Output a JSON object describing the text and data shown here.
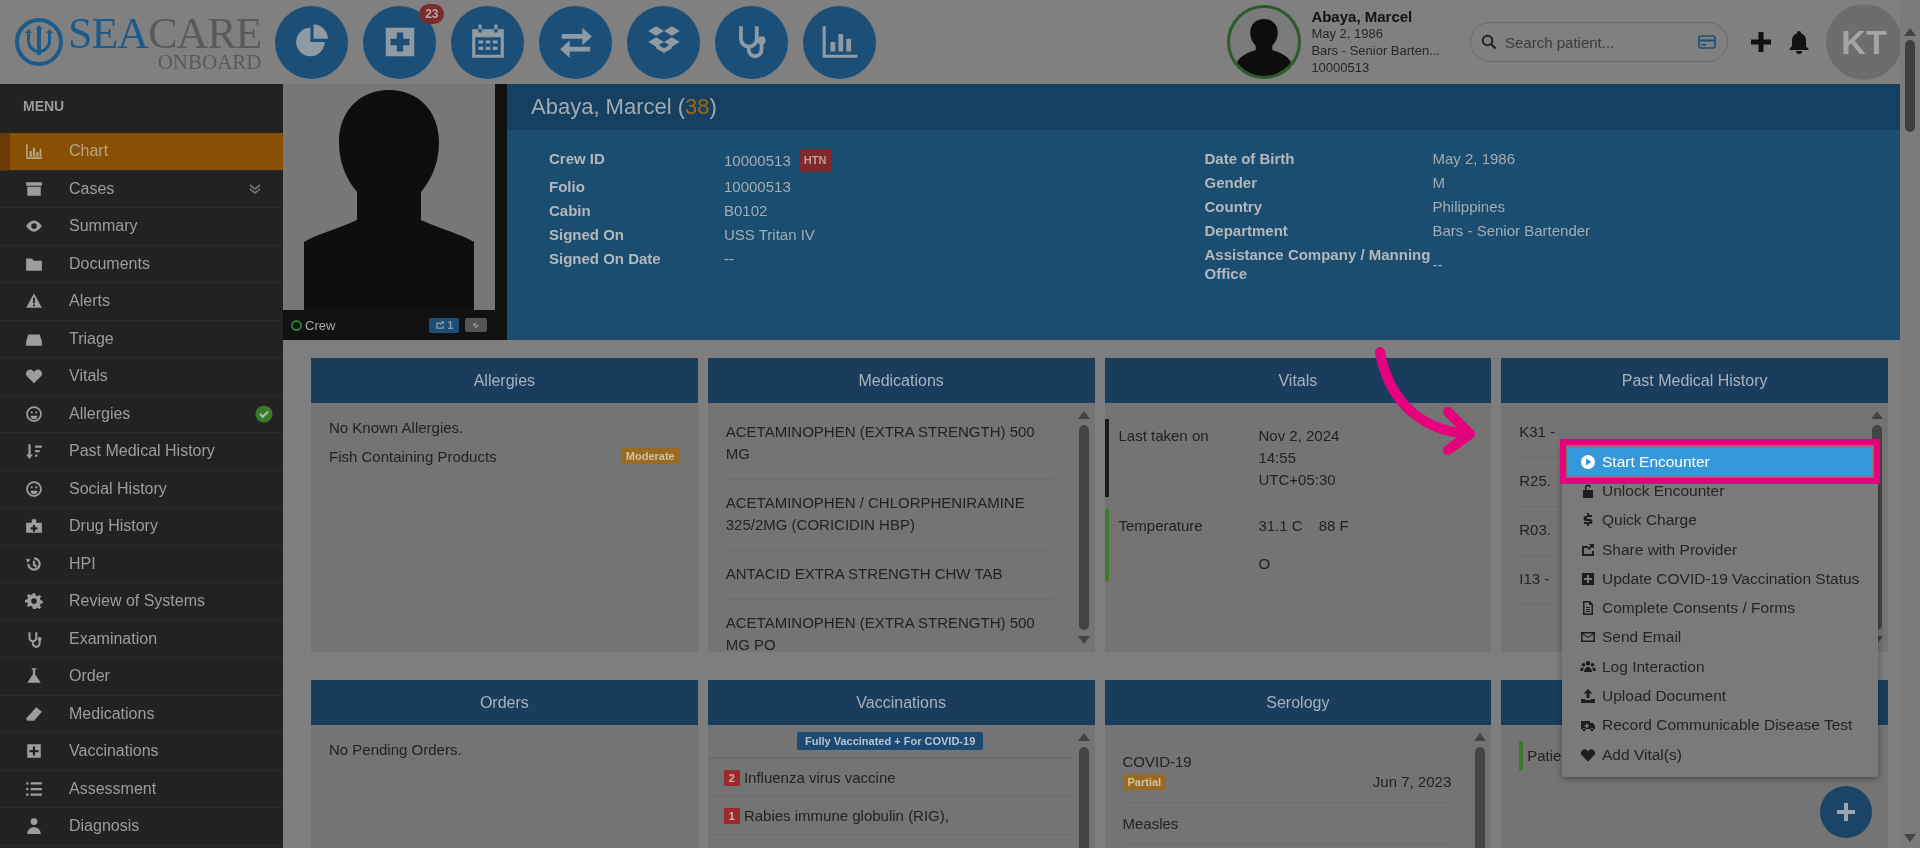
{
  "logo": {
    "part_1": "SEA",
    "part_2": "CARE",
    "subtitle": "ONBOARD"
  },
  "toolbar": {
    "badge": "23"
  },
  "patient_chip": {
    "name": "Abaya, Marcel",
    "dob": "May 2, 1986",
    "department": "Bars - Senior Barten...",
    "id": "10000513"
  },
  "search": {
    "placeholder": "Search patient..."
  },
  "user": {
    "initials": "KT"
  },
  "sidebar": {
    "title": "MENU",
    "items": [
      {
        "label": "Chart",
        "selected": true
      },
      {
        "label": "Cases",
        "selected": false,
        "expandable": true
      },
      {
        "label": "Summary",
        "selected": false
      },
      {
        "label": "Documents",
        "selected": false
      },
      {
        "label": "Alerts",
        "selected": false
      },
      {
        "label": "Triage",
        "selected": false
      },
      {
        "label": "Vitals",
        "selected": false
      },
      {
        "label": "Allergies",
        "selected": false,
        "checked": true
      },
      {
        "label": "Past Medical History",
        "selected": false
      },
      {
        "label": "Social History",
        "selected": false
      },
      {
        "label": "Drug History",
        "selected": false
      },
      {
        "label": "HPI",
        "selected": false
      },
      {
        "label": "Review of Systems",
        "selected": false
      },
      {
        "label": "Examination",
        "selected": false
      },
      {
        "label": "Order",
        "selected": false
      },
      {
        "label": "Medications",
        "selected": false
      },
      {
        "label": "Vaccinations",
        "selected": false
      },
      {
        "label": "Assessment",
        "selected": false
      },
      {
        "label": "Diagnosis",
        "selected": false
      }
    ]
  },
  "profile": {
    "status": "Crew",
    "share_count": "1"
  },
  "header": {
    "name": "Abaya, Marcel (",
    "age": "38",
    "suffix": ")",
    "fields_left": [
      {
        "label": "Crew ID",
        "value": "10000513",
        "tag": "HTN"
      },
      {
        "label": "Folio",
        "value": "10000513"
      },
      {
        "label": "Cabin",
        "value": "B0102"
      },
      {
        "label": "Signed On",
        "value": "USS Tritan IV"
      },
      {
        "label": "Signed On Date",
        "value": "--"
      }
    ],
    "fields_right": [
      {
        "label": "Date of Birth",
        "value": "May 2, 1986"
      },
      {
        "label": "Gender",
        "value": "M"
      },
      {
        "label": "Country",
        "value": "Philippines"
      },
      {
        "label": "Department",
        "value": "Bars - Senior Bartender"
      },
      {
        "label": "Assistance Company / Manning Office",
        "value": "--"
      }
    ]
  },
  "panels": [
    {
      "kind": "allergies",
      "title": "Allergies",
      "note": "No Known Allergies.",
      "items": [
        {
          "text": "Fish Containing Products",
          "severity": "Moderate"
        }
      ]
    },
    {
      "kind": "list",
      "title": "Medications",
      "items": [
        {
          "text": "ACETAMINOPHEN (EXTRA STRENGTH) 500 MG"
        },
        {
          "text": "ACETAMINOPHEN / CHLORPHENIRAMINE 325/2MG (CORICIDIN HBP)"
        },
        {
          "text": "ANTACID EXTRA STRENGTH CHW TAB"
        },
        {
          "text": "ACETAMINOPHEN (EXTRA STRENGTH) 500 MG PO"
        }
      ]
    },
    {
      "kind": "vitals",
      "title": "Vitals",
      "rows": [
        {
          "label": "Last taken on",
          "values": [
            "Nov 2, 2024 14:55 UTC+05:30"
          ],
          "color": "#1a1a1a"
        },
        {
          "label": "Temperature",
          "values": [
            "31.1 C",
            "88 F",
            "O"
          ],
          "color": "#3b7a2b"
        }
      ]
    },
    {
      "kind": "list",
      "title": "Past Medical History",
      "items": [
        {
          "text": "K31 -"
        },
        {
          "text": "R25."
        },
        {
          "text": "R03."
        },
        {
          "text": "I13 -"
        }
      ]
    },
    {
      "kind": "note",
      "title": "Orders",
      "note": "No Pending Orders."
    },
    {
      "kind": "vaccinations",
      "title": "Vaccinations",
      "banner": "Fully Vaccinated + For COVID-19",
      "items": [
        {
          "count": "2",
          "text": "Influenza virus vaccine"
        },
        {
          "count": "1",
          "text": "Rabies immune globulin (RIG),"
        }
      ]
    },
    {
      "kind": "serology",
      "title": "Serology",
      "items": [
        {
          "text": "COVID-19",
          "tag": "Partial",
          "date": "Jun 7, 2023"
        },
        {
          "text": "Measles"
        }
      ]
    },
    {
      "kind": "note",
      "note": "Patie",
      "color": "#3b7a2b"
    }
  ],
  "context_menu": {
    "items": [
      {
        "label": "Start Encounter",
        "selected": true
      },
      {
        "label": "Unlock Encounter",
        "selected": false
      },
      {
        "label": "Quick Charge",
        "selected": false
      },
      {
        "label": "Share with Provider",
        "selected": false
      },
      {
        "label": "Update COVID-19 Vaccination Status",
        "selected": false
      },
      {
        "label": "Complete Consents / Forms",
        "selected": false
      },
      {
        "label": "Send Email",
        "selected": false
      },
      {
        "label": "Log Interaction",
        "selected": false
      },
      {
        "label": "Upload Document",
        "selected": false
      },
      {
        "label": "Record Communicable Disease Test",
        "selected": false
      },
      {
        "label": "Add Vital(s)",
        "selected": false
      }
    ]
  }
}
